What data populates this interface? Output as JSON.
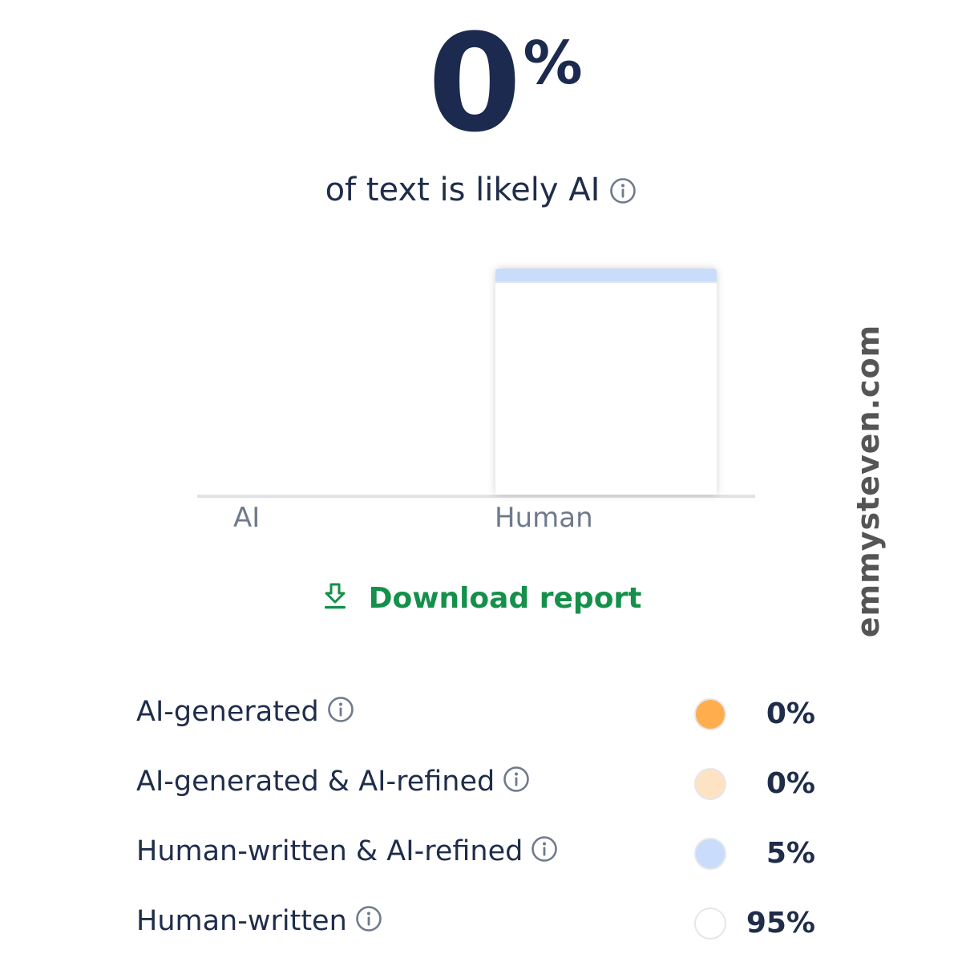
{
  "summary": {
    "value": "0",
    "unit": "%",
    "caption": "of text is likely AI",
    "info_icon": "info-icon"
  },
  "chart_data": {
    "type": "bar",
    "categories": [
      "AI",
      "Human"
    ],
    "values": [
      0,
      100
    ],
    "ylim": [
      0,
      100
    ],
    "grid": false,
    "human_segments": [
      {
        "name": "Human-written & AI-refined",
        "value": 5,
        "color": "#c9dcfb"
      },
      {
        "name": "Human-written",
        "value": 95,
        "color": "#ffffff"
      }
    ]
  },
  "download": {
    "label": "Download report",
    "icon": "download-icon",
    "color": "#14904a"
  },
  "legend": [
    {
      "label": "AI-generated",
      "color": "#ffad4d",
      "value": "0%"
    },
    {
      "label": "AI-generated & AI-refined",
      "color": "#fde3c3",
      "value": "0%"
    },
    {
      "label": "Human-written & AI-refined",
      "color": "#c9dcfb",
      "value": "5%"
    },
    {
      "label": "Human-written",
      "color": "#ffffff",
      "value": "95%"
    }
  ],
  "watermark": "emmysteven.com"
}
